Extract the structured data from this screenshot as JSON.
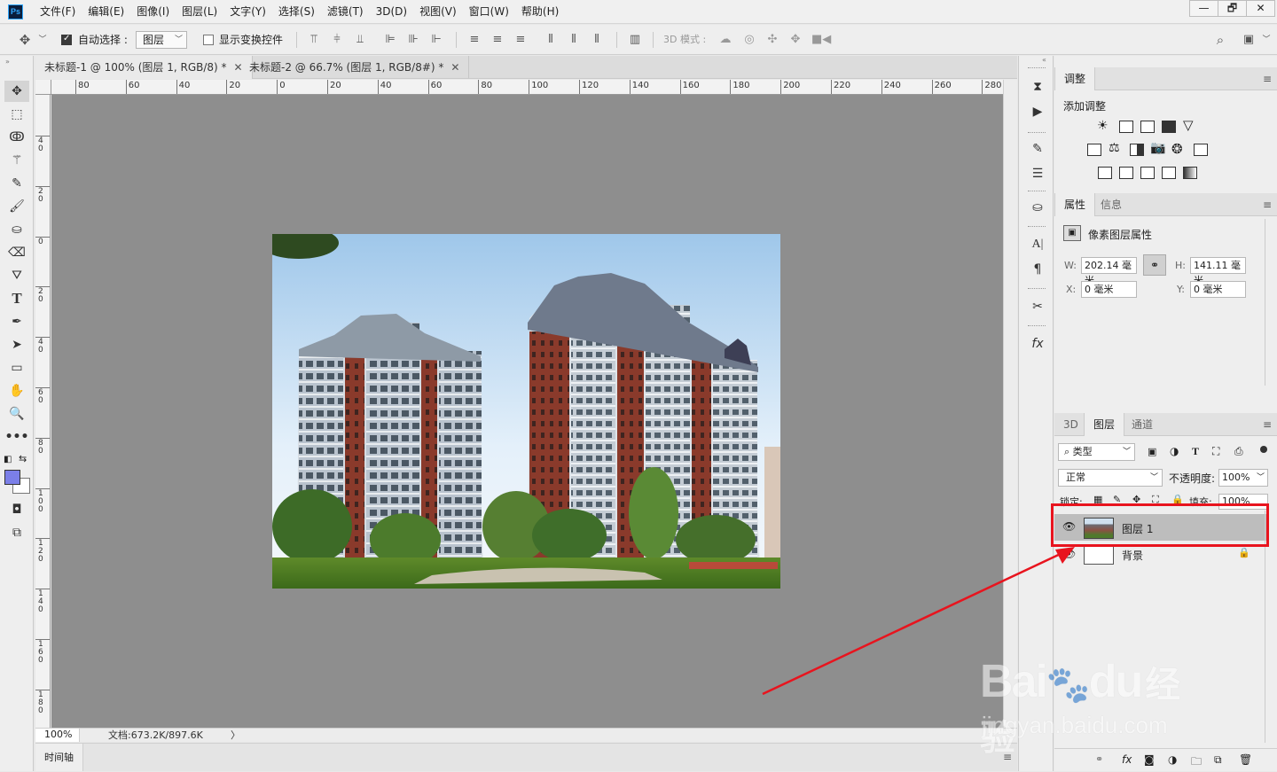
{
  "app": {
    "logo": "Ps"
  },
  "menu": [
    "文件(F)",
    "编辑(E)",
    "图像(I)",
    "图层(L)",
    "文字(Y)",
    "选择(S)",
    "滤镜(T)",
    "3D(D)",
    "视图(V)",
    "窗口(W)",
    "帮助(H)"
  ],
  "window_controls": [
    "—",
    "🗗",
    "✕"
  ],
  "options": {
    "auto_select_label": "自动选择 :",
    "auto_select_checked": true,
    "auto_select_target": "图层",
    "show_transform_label": "显示变换控件",
    "show_transform_checked": false,
    "mode_3d_label": "3D 模式 :"
  },
  "tabs": [
    {
      "label": "未标题-1 @ 100% (图层 1, RGB/8) *",
      "close": "✕",
      "active": true
    },
    {
      "label": "未标题-2 @ 66.7% (图层 1, RGB/8#) *",
      "close": "✕",
      "active": false
    }
  ],
  "ruler": {
    "h_labels": [
      "80",
      "60",
      "40",
      "20",
      "0",
      "20",
      "40",
      "60",
      "80",
      "100",
      "120",
      "140",
      "160",
      "180",
      "200",
      "220",
      "240",
      "260",
      "280"
    ],
    "v_labels": [
      "40",
      "20",
      "0",
      "20",
      "40",
      "60",
      "80",
      "100",
      "120",
      "140",
      "160",
      "180"
    ]
  },
  "status": {
    "zoom": "100%",
    "doc": "文档:673.2K/897.6K",
    "arrow": "〉"
  },
  "timeline": {
    "label": "时间轴"
  },
  "panels": {
    "adjust": {
      "tab": "调整",
      "add_label": "添加调整"
    },
    "properties": {
      "tabs": [
        "属性",
        "信息"
      ],
      "title": "像素图层属性",
      "w_label": "W:",
      "w_value": "202.14 毫米",
      "h_label": "H:",
      "h_value": "141.11 毫米",
      "x_label": "X:",
      "x_value": "0 毫米",
      "y_label": "Y:",
      "y_value": "0 毫米"
    },
    "layers": {
      "tabs": [
        "3D",
        "图层",
        "通道"
      ],
      "filter_kind": "类型",
      "blend_mode": "正常",
      "opacity_label": "不透明度:",
      "opacity_value": "100%",
      "lock_label": "锁定:",
      "fill_label": "填充:",
      "fill_value": "100%",
      "items": [
        {
          "name": "图层 1",
          "visible": true,
          "selected": true,
          "locked": false
        },
        {
          "name": "背景",
          "visible": true,
          "selected": false,
          "locked": true
        }
      ]
    }
  },
  "watermark": {
    "brand": "Bai",
    "brand_tail": "du",
    "cn": "经验",
    "url": "jingyan.baidu.com"
  },
  "colors": {
    "highlight": "#e8141e",
    "arrow": "#e8141e",
    "foreground": "#7b7fe8"
  }
}
